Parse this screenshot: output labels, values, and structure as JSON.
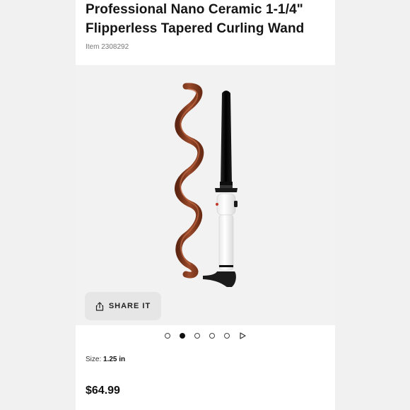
{
  "product": {
    "title_line1": "Professional Nano Ceramic 1-1/4\"",
    "title_line2": "Flipperless Tapered Curling Wand",
    "item_number": "Item 2308292"
  },
  "gallery": {
    "image_subject": "curling wand with curled hair strand",
    "share_label": "SHARE IT",
    "share_icon": "share-icon",
    "total_slides": 5,
    "active_slide": 2,
    "play_icon": "play-icon"
  },
  "details": {
    "size_label": "Size:",
    "size_value": "1.25 in",
    "price": "$64.99"
  },
  "colors": {
    "page_bg": "#ffffff",
    "outer_bg": "#f1f1f1",
    "gallery_bg": "#f2f2f2",
    "hair": "#8a3f22",
    "wand_barrel": "#111111",
    "wand_handle": "#ffffff"
  }
}
